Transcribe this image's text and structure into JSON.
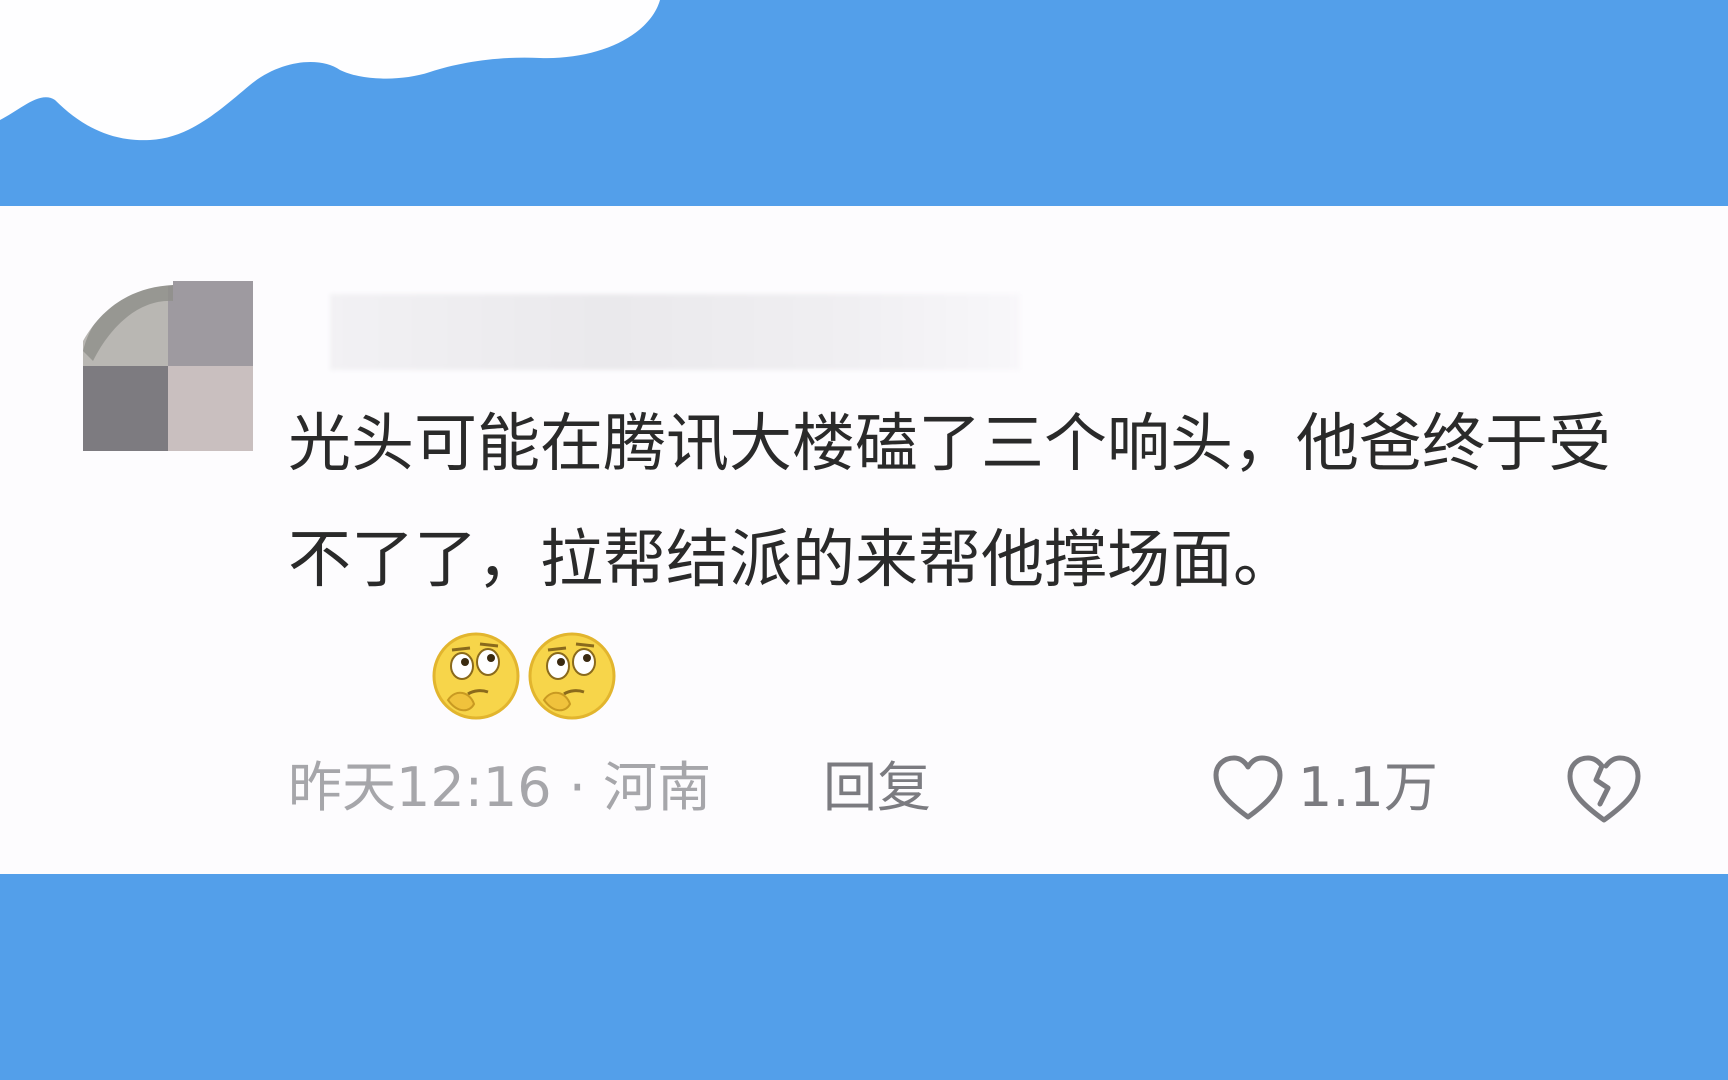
{
  "colors": {
    "band_blue": "#539fea",
    "card_background": "#fdfcfe",
    "text_primary": "#2a2a2a",
    "text_meta": "#a6a6aa",
    "text_action": "#7b7b80"
  },
  "comment": {
    "username": "",
    "text": "光头可能在腾讯大楼磕了三个响头，他爸终于受不了了，拉帮结派的来帮他撑场面。",
    "emojis": [
      "thinking-face-icon",
      "thinking-face-icon"
    ],
    "time": "昨天12:16",
    "separator": "·",
    "location": "河南",
    "reply_label": "回复",
    "like_count": "1.1万"
  },
  "icons": {
    "like": "heart-outline-icon",
    "dislike": "broken-heart-icon"
  }
}
